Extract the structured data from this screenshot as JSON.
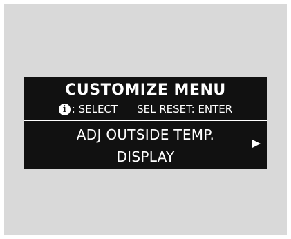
{
  "display": {
    "title": "CUSTOMIZE MENU",
    "select_text": ": SELECT",
    "reset_text": "SEL RESET: ENTER",
    "item_line1": "ADJ OUTSIDE TEMP.",
    "item_line2": "DISPLAY"
  },
  "icons": {
    "info": "info-icon",
    "next": "right-arrow-icon"
  },
  "colors": {
    "screen_bg": "#111111",
    "text": "#ffffff",
    "frame_bg": "#d9d9d9"
  }
}
